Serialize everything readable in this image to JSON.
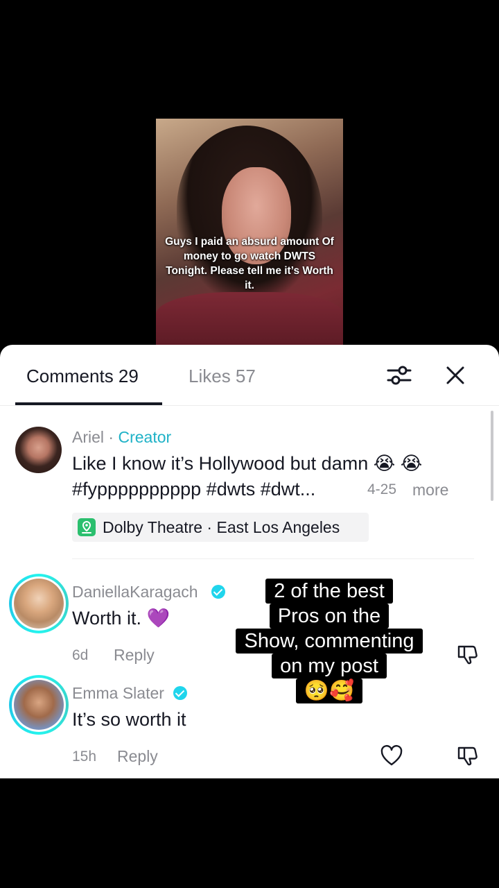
{
  "video": {
    "caption": "Guys I paid an absurd amount Of money to go watch DWTS Tonight. Please tell me it’s Worth it."
  },
  "tabs": {
    "comments": "Comments 29",
    "likes": "Likes 57"
  },
  "creator_comment": {
    "username": "Ariel",
    "separator": " · ",
    "badge": "Creator",
    "line1": "Like I know it’s Hollywood but damn 😭 😭",
    "line2": "#fypppppppppp #dwts #dwt...",
    "date": "4-25",
    "more": "more",
    "location": "Dolby Theatre · East Los Angeles"
  },
  "comments": [
    {
      "username": "DaniellaKaragach",
      "text": "Worth it. 💜",
      "time": "6d",
      "reply": "Reply"
    },
    {
      "username": "Emma Slater",
      "text": "It’s so worth it",
      "time": "15h",
      "reply": "Reply"
    }
  ],
  "overlay": {
    "lines": [
      "2 of the best",
      "Pros on the",
      "Show, commenting",
      "on my post",
      "🥺🥰"
    ]
  },
  "colors": {
    "accent": "#20d5ec",
    "creator": "#1fb2c7",
    "text": "#161823",
    "muted": "#8a8b91"
  },
  "icons": [
    "filter-icon",
    "close-icon",
    "location-pin-icon",
    "verified-icon",
    "heart-icon",
    "dislike-icon"
  ]
}
